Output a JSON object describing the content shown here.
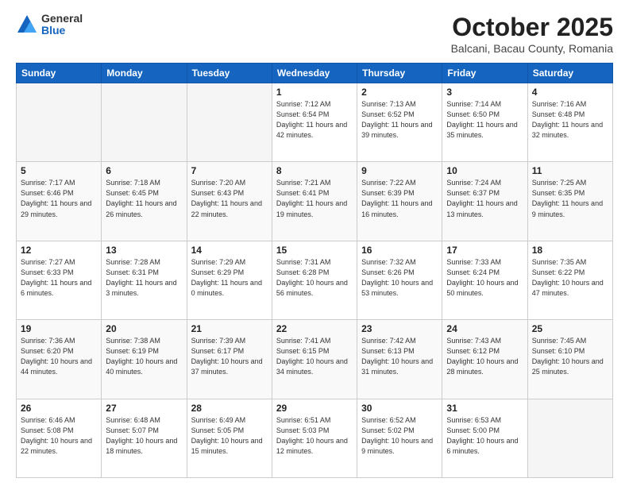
{
  "header": {
    "logo_general": "General",
    "logo_blue": "Blue",
    "month_title": "October 2025",
    "location": "Balcani, Bacau County, Romania"
  },
  "weekdays": [
    "Sunday",
    "Monday",
    "Tuesday",
    "Wednesday",
    "Thursday",
    "Friday",
    "Saturday"
  ],
  "weeks": [
    [
      {
        "day": "",
        "info": ""
      },
      {
        "day": "",
        "info": ""
      },
      {
        "day": "",
        "info": ""
      },
      {
        "day": "1",
        "info": "Sunrise: 7:12 AM\nSunset: 6:54 PM\nDaylight: 11 hours\nand 42 minutes."
      },
      {
        "day": "2",
        "info": "Sunrise: 7:13 AM\nSunset: 6:52 PM\nDaylight: 11 hours\nand 39 minutes."
      },
      {
        "day": "3",
        "info": "Sunrise: 7:14 AM\nSunset: 6:50 PM\nDaylight: 11 hours\nand 35 minutes."
      },
      {
        "day": "4",
        "info": "Sunrise: 7:16 AM\nSunset: 6:48 PM\nDaylight: 11 hours\nand 32 minutes."
      }
    ],
    [
      {
        "day": "5",
        "info": "Sunrise: 7:17 AM\nSunset: 6:46 PM\nDaylight: 11 hours\nand 29 minutes."
      },
      {
        "day": "6",
        "info": "Sunrise: 7:18 AM\nSunset: 6:45 PM\nDaylight: 11 hours\nand 26 minutes."
      },
      {
        "day": "7",
        "info": "Sunrise: 7:20 AM\nSunset: 6:43 PM\nDaylight: 11 hours\nand 22 minutes."
      },
      {
        "day": "8",
        "info": "Sunrise: 7:21 AM\nSunset: 6:41 PM\nDaylight: 11 hours\nand 19 minutes."
      },
      {
        "day": "9",
        "info": "Sunrise: 7:22 AM\nSunset: 6:39 PM\nDaylight: 11 hours\nand 16 minutes."
      },
      {
        "day": "10",
        "info": "Sunrise: 7:24 AM\nSunset: 6:37 PM\nDaylight: 11 hours\nand 13 minutes."
      },
      {
        "day": "11",
        "info": "Sunrise: 7:25 AM\nSunset: 6:35 PM\nDaylight: 11 hours\nand 9 minutes."
      }
    ],
    [
      {
        "day": "12",
        "info": "Sunrise: 7:27 AM\nSunset: 6:33 PM\nDaylight: 11 hours\nand 6 minutes."
      },
      {
        "day": "13",
        "info": "Sunrise: 7:28 AM\nSunset: 6:31 PM\nDaylight: 11 hours\nand 3 minutes."
      },
      {
        "day": "14",
        "info": "Sunrise: 7:29 AM\nSunset: 6:29 PM\nDaylight: 11 hours\nand 0 minutes."
      },
      {
        "day": "15",
        "info": "Sunrise: 7:31 AM\nSunset: 6:28 PM\nDaylight: 10 hours\nand 56 minutes."
      },
      {
        "day": "16",
        "info": "Sunrise: 7:32 AM\nSunset: 6:26 PM\nDaylight: 10 hours\nand 53 minutes."
      },
      {
        "day": "17",
        "info": "Sunrise: 7:33 AM\nSunset: 6:24 PM\nDaylight: 10 hours\nand 50 minutes."
      },
      {
        "day": "18",
        "info": "Sunrise: 7:35 AM\nSunset: 6:22 PM\nDaylight: 10 hours\nand 47 minutes."
      }
    ],
    [
      {
        "day": "19",
        "info": "Sunrise: 7:36 AM\nSunset: 6:20 PM\nDaylight: 10 hours\nand 44 minutes."
      },
      {
        "day": "20",
        "info": "Sunrise: 7:38 AM\nSunset: 6:19 PM\nDaylight: 10 hours\nand 40 minutes."
      },
      {
        "day": "21",
        "info": "Sunrise: 7:39 AM\nSunset: 6:17 PM\nDaylight: 10 hours\nand 37 minutes."
      },
      {
        "day": "22",
        "info": "Sunrise: 7:41 AM\nSunset: 6:15 PM\nDaylight: 10 hours\nand 34 minutes."
      },
      {
        "day": "23",
        "info": "Sunrise: 7:42 AM\nSunset: 6:13 PM\nDaylight: 10 hours\nand 31 minutes."
      },
      {
        "day": "24",
        "info": "Sunrise: 7:43 AM\nSunset: 6:12 PM\nDaylight: 10 hours\nand 28 minutes."
      },
      {
        "day": "25",
        "info": "Sunrise: 7:45 AM\nSunset: 6:10 PM\nDaylight: 10 hours\nand 25 minutes."
      }
    ],
    [
      {
        "day": "26",
        "info": "Sunrise: 6:46 AM\nSunset: 5:08 PM\nDaylight: 10 hours\nand 22 minutes."
      },
      {
        "day": "27",
        "info": "Sunrise: 6:48 AM\nSunset: 5:07 PM\nDaylight: 10 hours\nand 18 minutes."
      },
      {
        "day": "28",
        "info": "Sunrise: 6:49 AM\nSunset: 5:05 PM\nDaylight: 10 hours\nand 15 minutes."
      },
      {
        "day": "29",
        "info": "Sunrise: 6:51 AM\nSunset: 5:03 PM\nDaylight: 10 hours\nand 12 minutes."
      },
      {
        "day": "30",
        "info": "Sunrise: 6:52 AM\nSunset: 5:02 PM\nDaylight: 10 hours\nand 9 minutes."
      },
      {
        "day": "31",
        "info": "Sunrise: 6:53 AM\nSunset: 5:00 PM\nDaylight: 10 hours\nand 6 minutes."
      },
      {
        "day": "",
        "info": ""
      }
    ]
  ]
}
